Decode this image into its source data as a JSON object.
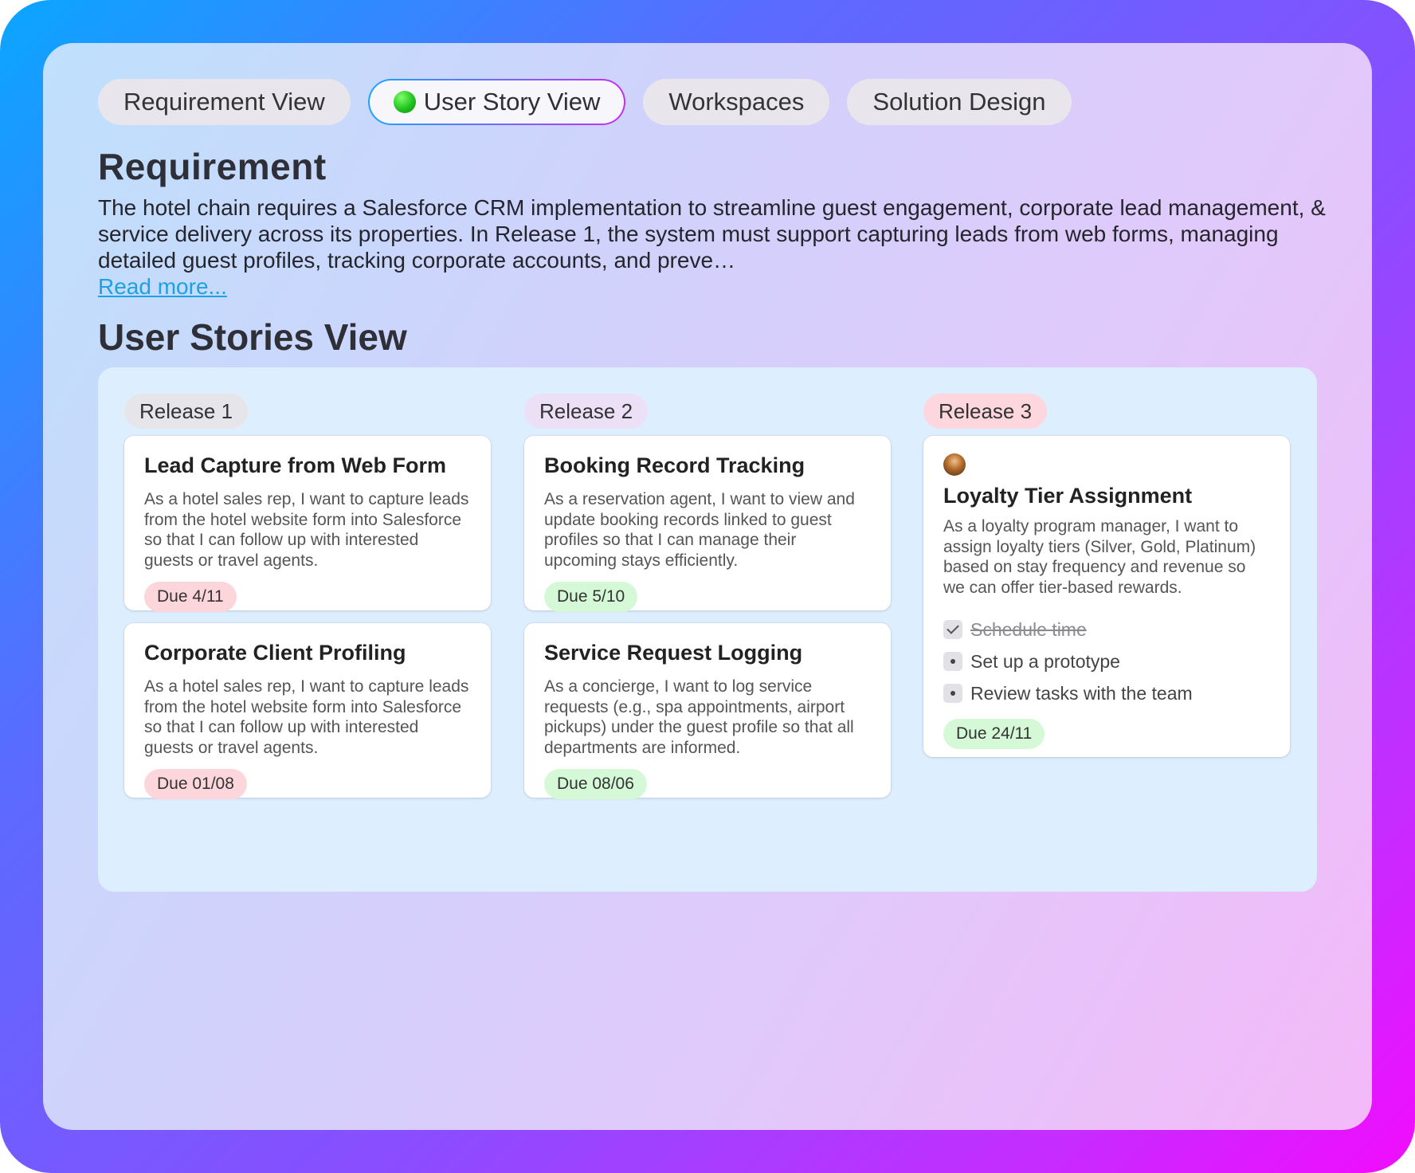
{
  "tabs": [
    {
      "label": "Requirement View",
      "active": false
    },
    {
      "label": "User Story View",
      "active": true
    },
    {
      "label": "Workspaces",
      "active": false
    },
    {
      "label": "Solution Design",
      "active": false
    }
  ],
  "requirement": {
    "heading": "Requirement",
    "text": "The hotel chain requires a Salesforce CRM implementation to streamline guest engagement, corporate lead management, & service delivery across its properties. In Release 1, the system must support capturing leads from web forms, managing detailed guest profiles, tracking corporate accounts, and preve…",
    "read_more": "Read more..."
  },
  "stories": {
    "heading": "User Stories View",
    "releases": [
      {
        "label": "Release 1",
        "cards": [
          {
            "title": "Lead Capture from Web Form",
            "desc": "As a hotel sales rep, I want to capture leads from the hotel website form into Salesforce so that I can follow up with interested guests or travel agents.",
            "due": "Due 4/11"
          },
          {
            "title": "Corporate Client Profiling",
            "desc": "As a hotel sales rep, I want to capture leads from the hotel website form into Salesforce so that I can follow up with interested guests or travel agents.",
            "due": "Due 01/08"
          }
        ]
      },
      {
        "label": "Release 2",
        "cards": [
          {
            "title": "Booking Record Tracking",
            "desc": "As a reservation agent, I want to view and update booking records linked to guest profiles so that I can manage their upcoming stays efficiently.",
            "due": "Due 5/10"
          },
          {
            "title": "Service Request Logging",
            "desc": "As a concierge, I want to log service requests (e.g., spa appointments, airport pickups) under the guest profile so that all departments are informed.",
            "due": "Due 08/06"
          }
        ]
      },
      {
        "label": "Release 3",
        "cards": [
          {
            "title": "Loyalty Tier Assignment",
            "desc": "As a loyalty program manager, I want to assign loyalty tiers (Silver, Gold, Platinum) based on stay frequency and revenue so we can offer tier-based rewards.",
            "due": "Due 24/11",
            "checklist": [
              {
                "label": "Schedule time",
                "done": true
              },
              {
                "label": "Set up a prototype",
                "done": false
              },
              {
                "label": "Review tasks with the team",
                "done": false
              }
            ]
          }
        ]
      }
    ]
  },
  "colors": {
    "due_red": "#fdd6dc",
    "due_green": "#d5f9d6",
    "link": "#1ca1e6"
  }
}
